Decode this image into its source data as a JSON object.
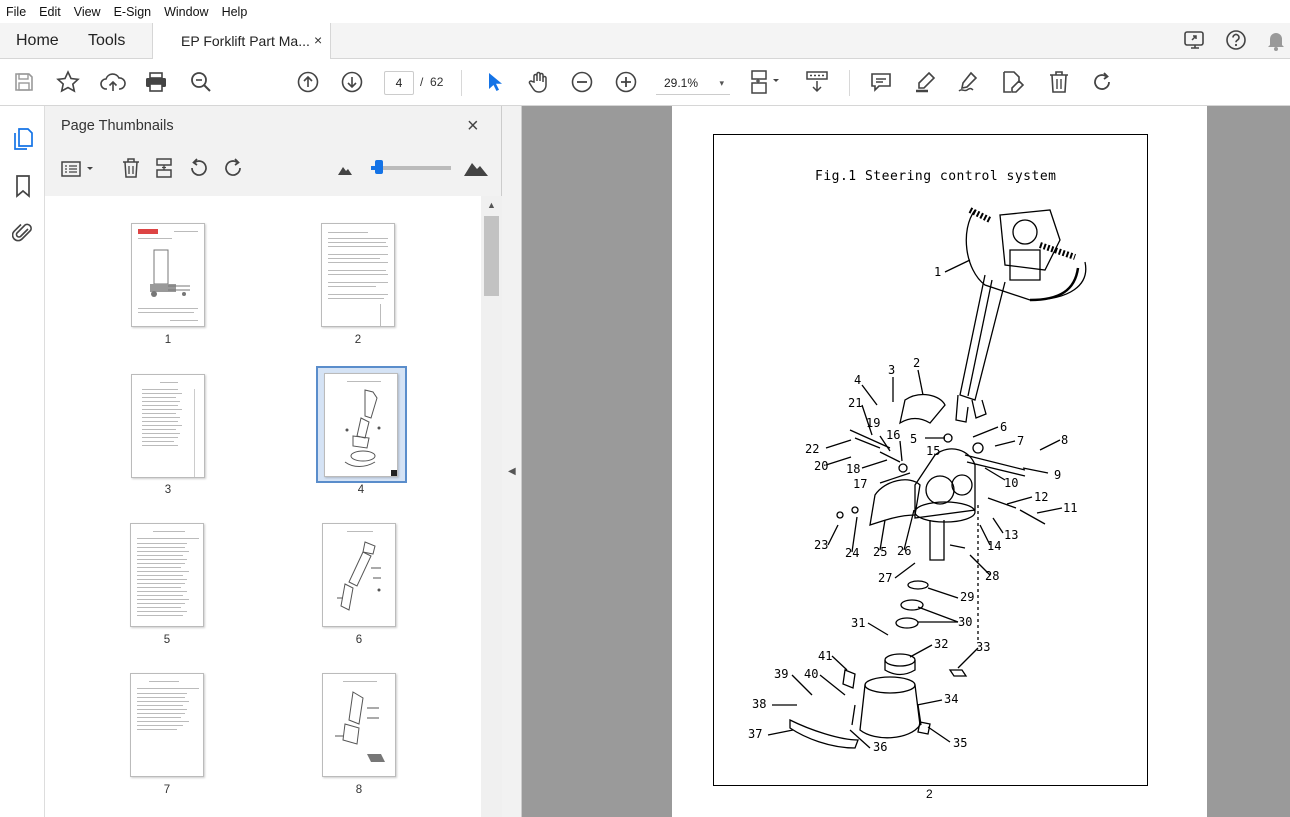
{
  "menu": [
    "File",
    "Edit",
    "View",
    "E-Sign",
    "Window",
    "Help"
  ],
  "tabs": {
    "home": "Home",
    "tools": "Tools",
    "doc_title": "EP Forklift Part Ma...",
    "close": "×"
  },
  "toolbar": {
    "current_page": "4",
    "page_sep": "/",
    "total_pages": "62",
    "zoom": "29.1%",
    "zoom_arrow": "▾"
  },
  "panel": {
    "title": "Page Thumbnails",
    "close": "×",
    "thumbnails": [
      {
        "label": "1"
      },
      {
        "label": "2"
      },
      {
        "label": "3"
      },
      {
        "label": "4"
      },
      {
        "label": "5"
      },
      {
        "label": "6"
      },
      {
        "label": "7"
      },
      {
        "label": "8"
      }
    ],
    "selected_page": "4",
    "thumb_size_level": 0.1
  },
  "document": {
    "fig_title": "Fig.1    Steering control system",
    "page_number": "2",
    "callouts": [
      "1",
      "2",
      "3",
      "4",
      "5",
      "6",
      "7",
      "8",
      "9",
      "10",
      "11",
      "12",
      "13",
      "14",
      "15",
      "16",
      "17",
      "18",
      "19",
      "20",
      "21",
      "22",
      "23",
      "24",
      "25",
      "26",
      "27",
      "28",
      "29",
      "30",
      "31",
      "32",
      "33",
      "34",
      "35",
      "36",
      "37",
      "38",
      "39",
      "40",
      "41"
    ]
  },
  "colors": {
    "accent": "#1473e6",
    "selection": "#5a8dcb",
    "viewer_bg": "#9a9a9a"
  }
}
